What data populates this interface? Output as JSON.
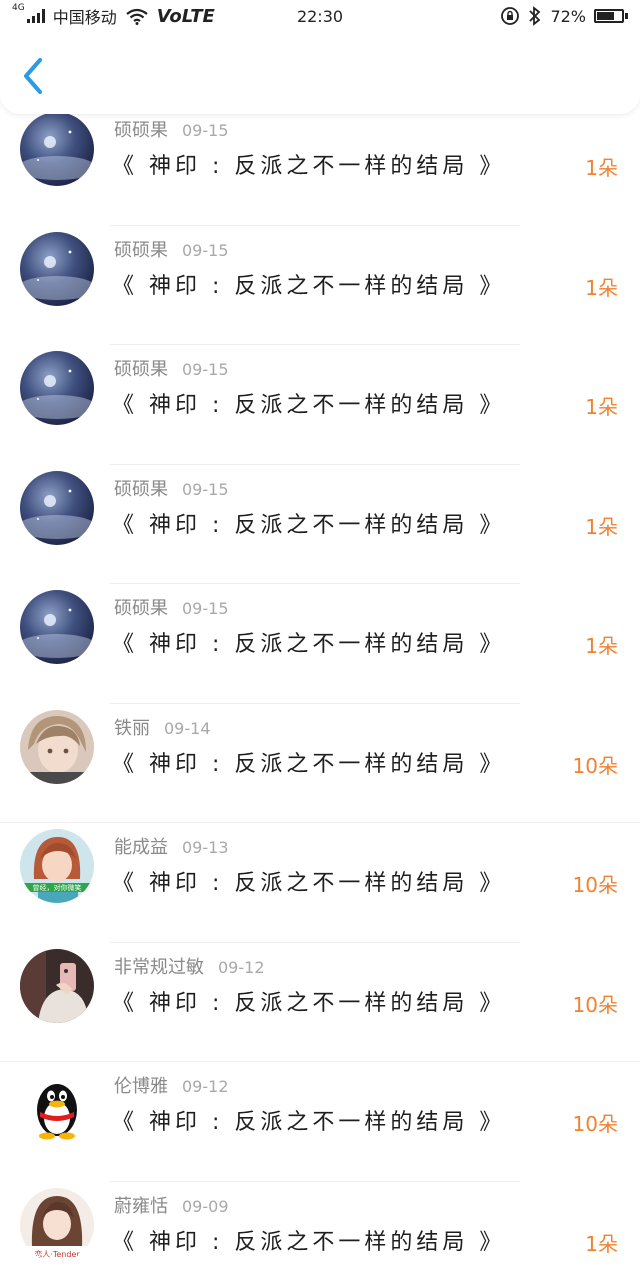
{
  "status_bar": {
    "network_tag": "4G",
    "carrier": "中国移动",
    "volte": "VoLTE",
    "time": "22:30",
    "battery_percent": "72%",
    "battery_level": 0.72
  },
  "header": {
    "back_icon": "chevron-left-icon"
  },
  "accent_color": "#f08232",
  "back_color": "#2b9ae9",
  "items": [
    {
      "user": "硕硕果",
      "date": "09-15",
      "title": "《 神印 : 反派之不一样的结局 》",
      "count": "1朵",
      "avatar": "planet"
    },
    {
      "user": "硕硕果",
      "date": "09-15",
      "title": "《 神印 : 反派之不一样的结局 》",
      "count": "1朵",
      "avatar": "planet"
    },
    {
      "user": "硕硕果",
      "date": "09-15",
      "title": "《 神印 : 反派之不一样的结局 》",
      "count": "1朵",
      "avatar": "planet"
    },
    {
      "user": "硕硕果",
      "date": "09-15",
      "title": "《 神印 : 反派之不一样的结局 》",
      "count": "1朵",
      "avatar": "planet"
    },
    {
      "user": "硕硕果",
      "date": "09-15",
      "title": "《 神印 : 反派之不一样的结局 》",
      "count": "1朵",
      "avatar": "planet"
    },
    {
      "user": "铁丽",
      "date": "09-14",
      "title": "《 神印 : 反派之不一样的结局 》",
      "count": "10朵",
      "avatar": "anime-boy"
    },
    {
      "user": "能成益",
      "date": "09-13",
      "title": "《 神印 : 反派之不一样的结局 》",
      "count": "10朵",
      "avatar": "girl-photo",
      "avatar_text": "曾经，对你微笑"
    },
    {
      "user": "非常规过敏",
      "date": "09-12",
      "title": "《 神印 : 反派之不一样的结局 》",
      "count": "10朵",
      "avatar": "phone-photo"
    },
    {
      "user": "伦博雅",
      "date": "09-12",
      "title": "《 神印 : 反派之不一样的结局 》",
      "count": "10朵",
      "avatar": "qq-penguin"
    },
    {
      "user": "蔚雍恬",
      "date": "09-09",
      "title": "《 神印 : 反派之不一样的结局 》",
      "count": "1朵",
      "avatar": "tender-girl",
      "avatar_text": "恋人·Tender"
    }
  ]
}
